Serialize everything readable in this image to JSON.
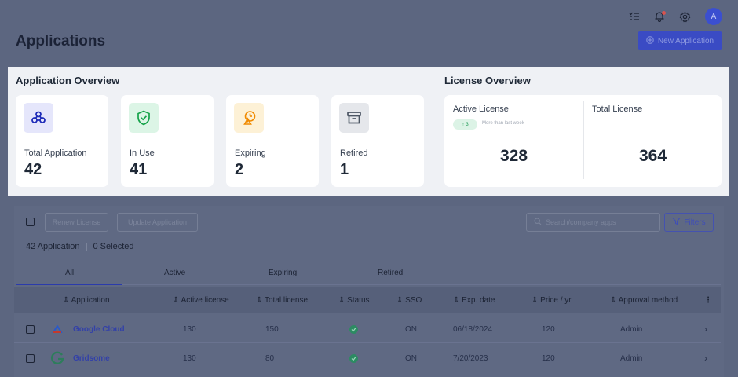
{
  "header": {
    "title": "Applications",
    "new_button": "New Application",
    "avatar": "A",
    "icons": [
      "tasks-icon",
      "bell-icon",
      "gear-icon"
    ]
  },
  "overview": {
    "title": "Application Overview",
    "cards": [
      {
        "label": "Total Application",
        "value": "42",
        "icon": "apps-icon",
        "color": "#4338ca"
      },
      {
        "label": "In Use",
        "value": "41",
        "icon": "shield-check-icon",
        "color": "#16a34a"
      },
      {
        "label": "Expiring",
        "value": "2",
        "icon": "warning-icon",
        "color": "#f59e0b"
      },
      {
        "label": "Retired",
        "value": "1",
        "icon": "archive-icon",
        "color": "#475569"
      }
    ]
  },
  "license": {
    "title": "License Overview",
    "active_label": "Active License",
    "active_value": "328",
    "badge": "3",
    "badge_note": "More than last week",
    "total_label": "Total License",
    "total_value": "364"
  },
  "toolbar": {
    "renew": "Renew License",
    "update": "Update Application",
    "search_placeholder": "Search/company apps",
    "filters": "Filters"
  },
  "counts": {
    "apps": "42 Application",
    "selected": "0 Selected"
  },
  "tabs": [
    "All",
    "Active",
    "Expiring",
    "Retired"
  ],
  "table": {
    "columns": [
      "Application",
      "Active license",
      "Total license",
      "Status",
      "SSO",
      "Exp. date",
      "Price / yr",
      "Approval method"
    ],
    "rows": [
      {
        "name": "Google Cloud",
        "active": "130",
        "total": "150",
        "sso": "ON",
        "exp": "06/18/2024",
        "price": "120",
        "approval": "Admin"
      },
      {
        "name": "Gridsome",
        "active": "130",
        "total": "80",
        "sso": "ON",
        "exp": "7/20/2023",
        "price": "120",
        "approval": "Admin"
      }
    ]
  }
}
